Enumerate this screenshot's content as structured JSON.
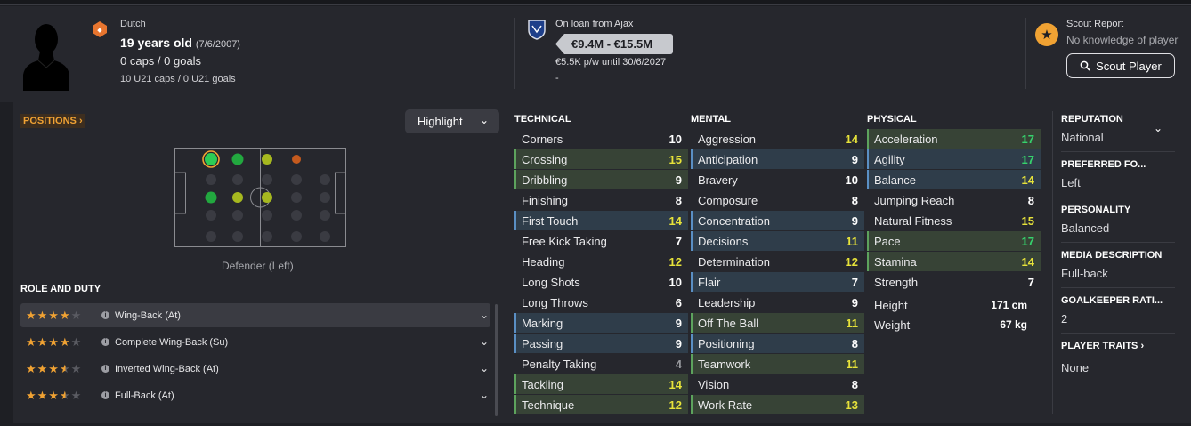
{
  "header": {
    "nationality": "Dutch",
    "age": "19 years old",
    "dob": "(7/6/2007)",
    "caps": "0 caps / 0 goals",
    "u21": "10 U21 caps / 0 U21 goals",
    "loan": "On loan from Ajax",
    "value": "€9.4M - €15.5M",
    "wage": "€5.5K p/w until 30/6/2027",
    "dash": "-",
    "scout_title": "Scout Report",
    "scout_sub": "No knowledge of player",
    "scout_button": "Scout Player"
  },
  "positions": {
    "button": "POSITIONS",
    "highlight": "Highlight",
    "label": "Defender (Left)"
  },
  "roles": {
    "title": "ROLE AND DUTY",
    "items": [
      {
        "name": "Wing-Back (At)",
        "stars": 4
      },
      {
        "name": "Complete Wing-Back (Su)",
        "stars": 4
      },
      {
        "name": "Inverted Wing-Back (At)",
        "stars": 3.5
      },
      {
        "name": "Full-Back (At)",
        "stars": 3.5
      }
    ]
  },
  "technical": {
    "title": "TECHNICAL",
    "items": [
      {
        "name": "Corners",
        "value": "10"
      },
      {
        "name": "Crossing",
        "value": "15"
      },
      {
        "name": "Dribbling",
        "value": "9"
      },
      {
        "name": "Finishing",
        "value": "8"
      },
      {
        "name": "First Touch",
        "value": "14"
      },
      {
        "name": "Free Kick Taking",
        "value": "7"
      },
      {
        "name": "Heading",
        "value": "12"
      },
      {
        "name": "Long Shots",
        "value": "10"
      },
      {
        "name": "Long Throws",
        "value": "6"
      },
      {
        "name": "Marking",
        "value": "9"
      },
      {
        "name": "Passing",
        "value": "9"
      },
      {
        "name": "Penalty Taking",
        "value": "4"
      },
      {
        "name": "Tackling",
        "value": "14"
      },
      {
        "name": "Technique",
        "value": "12"
      }
    ]
  },
  "mental": {
    "title": "MENTAL",
    "items": [
      {
        "name": "Aggression",
        "value": "14"
      },
      {
        "name": "Anticipation",
        "value": "9"
      },
      {
        "name": "Bravery",
        "value": "10"
      },
      {
        "name": "Composure",
        "value": "8"
      },
      {
        "name": "Concentration",
        "value": "9"
      },
      {
        "name": "Decisions",
        "value": "11"
      },
      {
        "name": "Determination",
        "value": "12"
      },
      {
        "name": "Flair",
        "value": "7"
      },
      {
        "name": "Leadership",
        "value": "9"
      },
      {
        "name": "Off The Ball",
        "value": "11"
      },
      {
        "name": "Positioning",
        "value": "8"
      },
      {
        "name": "Teamwork",
        "value": "11"
      },
      {
        "name": "Vision",
        "value": "8"
      },
      {
        "name": "Work Rate",
        "value": "13"
      }
    ]
  },
  "physical": {
    "title": "PHYSICAL",
    "items": [
      {
        "name": "Acceleration",
        "value": "17"
      },
      {
        "name": "Agility",
        "value": "17"
      },
      {
        "name": "Balance",
        "value": "14"
      },
      {
        "name": "Jumping Reach",
        "value": "8"
      },
      {
        "name": "Natural Fitness",
        "value": "15"
      },
      {
        "name": "Pace",
        "value": "17"
      },
      {
        "name": "Stamina",
        "value": "14"
      },
      {
        "name": "Strength",
        "value": "7"
      }
    ],
    "height_label": "Height",
    "height": "171 cm",
    "weight_label": "Weight",
    "weight": "67 kg"
  },
  "info": {
    "reputation_title": "REPUTATION",
    "reputation": "National",
    "foot_title": "PREFERRED FO...",
    "foot": "Left",
    "personality_title": "PERSONALITY",
    "personality": "Balanced",
    "media_title": "MEDIA DESCRIPTION",
    "media": "Full-back",
    "gk_title": "GOALKEEPER RATI...",
    "gk": "2",
    "traits_title": "PLAYER TRAITS",
    "traits": "None"
  },
  "colors": {
    "accent": "#f0a233",
    "green_row": "#374336",
    "blue_row": "#2f3d4a",
    "attr_high": "#36d36d",
    "attr_good": "#e7e33a"
  }
}
